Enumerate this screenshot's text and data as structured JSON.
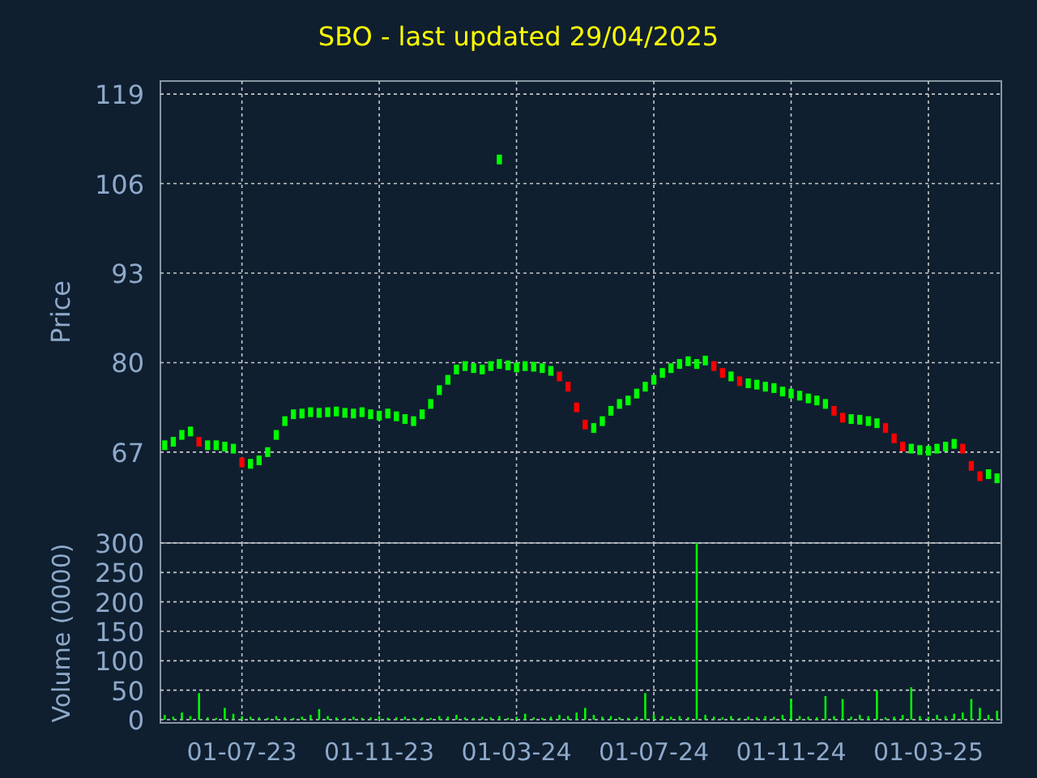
{
  "title": "SBO - last updated 29/04/2025",
  "price_chart": {
    "chart_data": {
      "type": "scatter",
      "ylabel": "Price",
      "grid": true,
      "categories": [
        null,
        null,
        null,
        null,
        null,
        null,
        null,
        null,
        null,
        null,
        null,
        null,
        null,
        null,
        null,
        null,
        null,
        null,
        null,
        null,
        null,
        null,
        null,
        null,
        null,
        null,
        null,
        null,
        null,
        null,
        null,
        null,
        null,
        null,
        null,
        null,
        null,
        null,
        null,
        null,
        null,
        null,
        null,
        null,
        null,
        null,
        null,
        null,
        null,
        null,
        null,
        null,
        null,
        null,
        null,
        null,
        null,
        null,
        null,
        null,
        null,
        null,
        null,
        null,
        null,
        null,
        null,
        null,
        null,
        null,
        null,
        null,
        null,
        null,
        null,
        null,
        null,
        null,
        null,
        null,
        null,
        null,
        null,
        null,
        null,
        null,
        null,
        null,
        null,
        null,
        null,
        null,
        null,
        null,
        null,
        null,
        null,
        null
      ],
      "series": [
        {
          "color": "#00ff00",
          "values": [
            68,
            68.5,
            69.5,
            70,
            null,
            68,
            68,
            67.8,
            67.5,
            null,
            65.3,
            65.8,
            67,
            69.5,
            71.5,
            72.5,
            72.6,
            72.8,
            72.7,
            72.8,
            72.9,
            72.7,
            72.6,
            72.8,
            72.5,
            72.3,
            72.6,
            72.2,
            71.8,
            71.5,
            72.5,
            74,
            76,
            77.5,
            79,
            79.5,
            79.2,
            79,
            79.5,
            79.8,
            79.6,
            79.3,
            79.5,
            79.4,
            79.2,
            78.8,
            null,
            null,
            null,
            null,
            70.5,
            71.5,
            73,
            74,
            74.5,
            75.5,
            76.5,
            77.5,
            78.5,
            79.2,
            79.8,
            80.2,
            79.8,
            80.3,
            null,
            null,
            78,
            null,
            77,
            76.8,
            76.5,
            76.3,
            75.8,
            75.5,
            75.2,
            74.8,
            74.5,
            74,
            null,
            null,
            71.8,
            71.7,
            71.5,
            71.2,
            null,
            null,
            null,
            67.5,
            67.3,
            67.2,
            67.5,
            67.8,
            68.2,
            null,
            null,
            null,
            63.8,
            63.2
          ]
        },
        {
          "color": "#ff0000",
          "values": [
            null,
            null,
            null,
            null,
            68.5,
            null,
            null,
            null,
            null,
            65.5,
            null,
            null,
            null,
            null,
            null,
            null,
            null,
            null,
            null,
            null,
            null,
            null,
            null,
            null,
            null,
            null,
            null,
            null,
            null,
            null,
            null,
            null,
            null,
            null,
            null,
            null,
            null,
            null,
            null,
            null,
            null,
            null,
            null,
            null,
            null,
            null,
            78,
            76.5,
            73.5,
            71,
            null,
            null,
            null,
            null,
            null,
            null,
            null,
            null,
            null,
            null,
            null,
            null,
            null,
            null,
            79.5,
            78.5,
            null,
            77.3,
            null,
            null,
            null,
            null,
            null,
            null,
            null,
            null,
            null,
            null,
            73,
            72,
            null,
            null,
            null,
            null,
            70.5,
            69,
            67.8,
            null,
            null,
            null,
            null,
            null,
            null,
            67.5,
            65,
            63.5,
            null,
            null
          ]
        },
        {
          "color": "#00ff00",
          "values": [
            null,
            null,
            null,
            null,
            null,
            null,
            null,
            null,
            null,
            null,
            null,
            null,
            null,
            null,
            null,
            null,
            null,
            null,
            null,
            null,
            null,
            null,
            null,
            null,
            null,
            null,
            null,
            null,
            null,
            null,
            null,
            null,
            null,
            null,
            null,
            null,
            null,
            null,
            null,
            109.5,
            null,
            null,
            null,
            null,
            null,
            null,
            null,
            null,
            null,
            null,
            null,
            null,
            null,
            null,
            null,
            null,
            null,
            null,
            null,
            null,
            null,
            null,
            null,
            null,
            null,
            null,
            null,
            null,
            null,
            null,
            null,
            null,
            null,
            null,
            null,
            null,
            null,
            null,
            null,
            null,
            null,
            null,
            null,
            null,
            null,
            null,
            null,
            null,
            null,
            null,
            null,
            null,
            null,
            null,
            null,
            null,
            null,
            null
          ]
        }
      ],
      "ylim": [
        53.8,
        120.9
      ],
      "yticks": [
        67,
        80,
        93,
        106,
        119
      ]
    }
  },
  "volume_chart": {
    "chart_data": {
      "type": "bar",
      "ylabel": "Volume (0000)",
      "grid": true,
      "categories": [
        null,
        null,
        null,
        null,
        null,
        null,
        null,
        null,
        null,
        "01-07-23",
        null,
        null,
        null,
        null,
        null,
        null,
        null,
        null,
        null,
        null,
        null,
        null,
        null,
        null,
        null,
        "01-11-23",
        null,
        null,
        null,
        null,
        null,
        null,
        null,
        null,
        null,
        null,
        null,
        null,
        null,
        null,
        null,
        "01-03-24",
        null,
        null,
        null,
        null,
        null,
        null,
        null,
        null,
        null,
        null,
        null,
        null,
        null,
        null,
        null,
        "01-07-24",
        null,
        null,
        null,
        null,
        null,
        null,
        null,
        null,
        null,
        null,
        null,
        null,
        null,
        null,
        null,
        "01-11-24",
        null,
        null,
        null,
        null,
        null,
        null,
        null,
        null,
        null,
        null,
        null,
        null,
        null,
        null,
        null,
        "01-03-25",
        null,
        null,
        null,
        null,
        null,
        null,
        null,
        null
      ],
      "series": [
        {
          "color": "#00ff00",
          "values": [
            8,
            5,
            12,
            6,
            45,
            4,
            3,
            20,
            10,
            6,
            5,
            4,
            3,
            6,
            4,
            3,
            5,
            8,
            18,
            6,
            4,
            3,
            5,
            3,
            4,
            6,
            3,
            4,
            5,
            3,
            4,
            3,
            6,
            5,
            8,
            4,
            3,
            5,
            4,
            6,
            3,
            5,
            10,
            4,
            3,
            5,
            8,
            6,
            12,
            20,
            8,
            5,
            6,
            4,
            3,
            5,
            45,
            8,
            6,
            5,
            6,
            4,
            300,
            8,
            5,
            4,
            6,
            3,
            5,
            4,
            6,
            5,
            8,
            35,
            6,
            5,
            4,
            40,
            6,
            35,
            5,
            8,
            6,
            50,
            4,
            5,
            8,
            55,
            6,
            5,
            8,
            6,
            10,
            12,
            35,
            20,
            8,
            15
          ]
        }
      ],
      "ylim": [
        0,
        300
      ],
      "yticks": [
        0,
        50,
        100,
        150,
        200,
        250,
        300
      ]
    }
  }
}
